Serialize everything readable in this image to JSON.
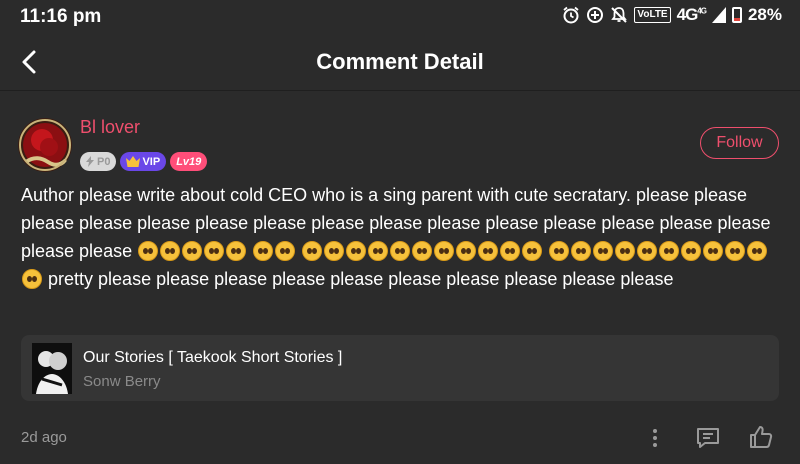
{
  "status_bar": {
    "time": "11:16 pm",
    "volte": "VoLTE",
    "network": "4G",
    "network_small": "4G",
    "battery": "28%",
    "battery_level": 0.28
  },
  "header": {
    "title": "Comment Detail"
  },
  "comment": {
    "username": "Bl lover",
    "badges": {
      "p0": "P0",
      "vip": "VIP",
      "level": "Lv19"
    },
    "follow_label": "Follow",
    "text_part1": "Author please write about cold CEO who is a sing parent with cute secratary. please please please please please please please please please please please please please please please please please",
    "text_part2": "pretty please please please please please please please please please please",
    "emoji_groups": [
      5,
      2,
      11,
      11
    ],
    "emoji_name": "pleading-face",
    "time_ago": "2d ago"
  },
  "story": {
    "title": "Our Stories [ Taekook Short Stories ]",
    "author": "Sonw Berry"
  },
  "colors": {
    "background": "#2b2b2b",
    "accent": "#ef4f6d",
    "card": "#353535",
    "vip": "#6a47e8",
    "level": "#ff4e79"
  }
}
